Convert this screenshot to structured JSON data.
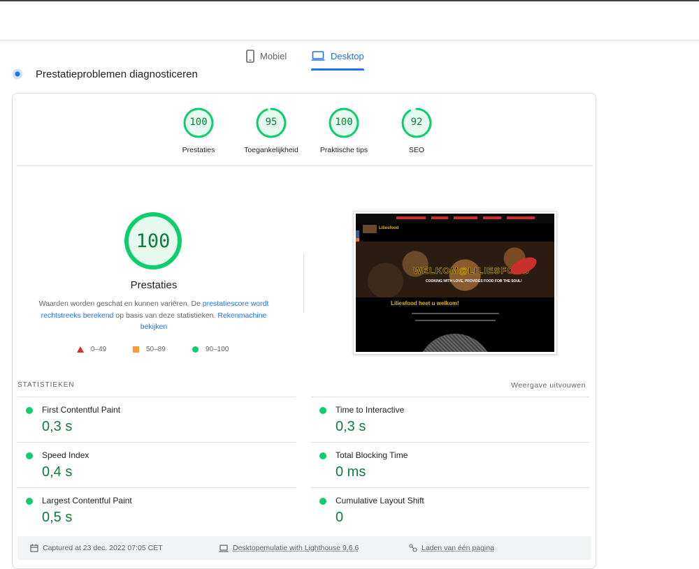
{
  "tabs": {
    "mobile": "Mobiel",
    "desktop": "Desktop"
  },
  "section": {
    "title": "Prestatieproblemen diagnosticeren"
  },
  "categories": [
    {
      "label": "Prestaties",
      "score": "100",
      "value": 100
    },
    {
      "label": "Toegankelijkheid",
      "score": "95",
      "value": 95
    },
    {
      "label": "Praktische tips",
      "score": "100",
      "value": 100
    },
    {
      "label": "SEO",
      "score": "92",
      "value": 92
    }
  ],
  "main_score": {
    "score": "100",
    "value": 100,
    "label": "Prestaties"
  },
  "description": {
    "t1": "Waarden worden geschat en kunnen variëren. De ",
    "link1": "prestatiescore wordt rechtstreeks berekend",
    "t2": " op basis van deze statistieken. ",
    "link2": "Rekenmachine bekijken"
  },
  "legend": {
    "fail": "0–49",
    "average": "50–89",
    "pass": "90–100"
  },
  "screenshot": {
    "brand": "Liliesfood",
    "hero_title": "WELKOM@LILIESFOOD",
    "hero_sub": "COOKING WITH LOVE, PROVIDES FOOD FOR THE SOUL!",
    "welcome": "Liliesfood heet u welkom!"
  },
  "stats": {
    "heading": "STATISTIEKEN",
    "expand": "Weergave uitvouwen",
    "metrics": [
      {
        "label": "First Contentful Paint",
        "value": "0,3 s"
      },
      {
        "label": "Time to Interactive",
        "value": "0,3 s"
      },
      {
        "label": "Speed Index",
        "value": "0,4 s"
      },
      {
        "label": "Total Blocking Time",
        "value": "0 ms"
      },
      {
        "label": "Largest Contentful Paint",
        "value": "0,5 s"
      },
      {
        "label": "Cumulative Layout Shift",
        "value": "0"
      }
    ]
  },
  "footer": {
    "captured": "Captured at 23 dec. 2022 07:05 CET",
    "emulation": "Desktopemulatie with Lighthouse 9.6.6",
    "load": "Laden van één pagina"
  },
  "colors": {
    "pass": "#0cce6b",
    "pass_text": "#0c7d3a",
    "average": "#fa9b3e",
    "fail": "#d93025",
    "accent": "#1a73e8"
  }
}
